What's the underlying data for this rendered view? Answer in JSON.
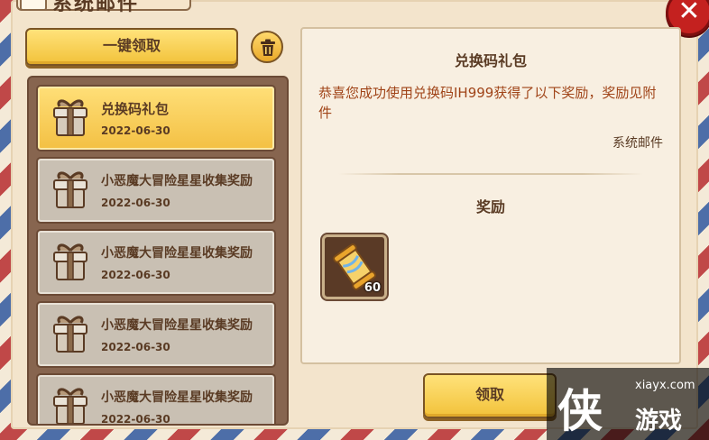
{
  "window": {
    "title": "系统邮件"
  },
  "toolbar": {
    "claim_all_label": "一键领取"
  },
  "mails": [
    {
      "title": "兑换码礼包",
      "date": "2022-06-30",
      "selected": true
    },
    {
      "title": "小恶魔大冒险星星收集奖励",
      "date": "2022-06-30",
      "selected": false
    },
    {
      "title": "小恶魔大冒险星星收集奖励",
      "date": "2022-06-30",
      "selected": false
    },
    {
      "title": "小恶魔大冒险星星收集奖励",
      "date": "2022-06-30",
      "selected": false
    },
    {
      "title": "小恶魔大冒险星星收集奖励",
      "date": "2022-06-30",
      "selected": false
    }
  ],
  "detail": {
    "title": "兑换码礼包",
    "body": "恭喜您成功使用兑换码IH999获得了以下奖励，奖励见附件",
    "sender": "系统邮件",
    "reward_header": "奖励",
    "rewards": [
      {
        "icon": "scroll-icon",
        "quantity": "60"
      }
    ],
    "claim_label": "领取"
  },
  "watermark": {
    "url": "xiayx.com",
    "char": "侠",
    "name": "游戏"
  },
  "colors": {
    "accent_yellow": "#f2c23a",
    "close_red": "#c4211f",
    "text_brown": "#5a3b24",
    "body_orange": "#a04418"
  }
}
